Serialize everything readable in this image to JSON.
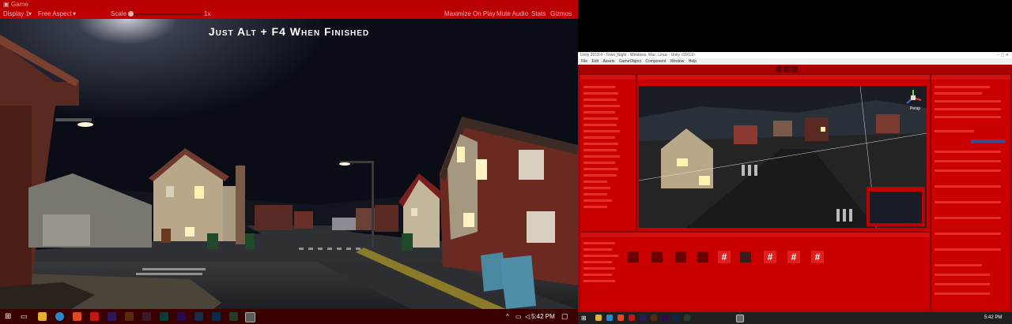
{
  "game_window": {
    "title": "Game",
    "toolbar": {
      "display": "Display 1",
      "aspect": "Free Aspect",
      "scale_label": "Scale",
      "scale_value": "1x",
      "maximize_on_play": "Maximize On Play",
      "mute_audio": "Mute Audio",
      "stats": "Stats",
      "gizmos": "Gizmos"
    },
    "overlay_text": "Just Alt + F4 When Finished"
  },
  "taskbar_left": {
    "time": "5:42 PM",
    "icons": [
      "windows-icon",
      "search-icon",
      "taskview-icon",
      "file-explorer-icon",
      "edge-icon",
      "brave-icon",
      "acrobat-icon",
      "after-effects-icon",
      "illustrator-icon",
      "animate-icon",
      "audition-icon",
      "premiere-icon",
      "character-animator-icon",
      "photoshop-icon",
      "substance-icon",
      "bridge-icon",
      "unity-icon",
      "visual-studio-icon"
    ]
  },
  "unity_editor": {
    "title": "Unity 2019.4 - Town_Night - Windows, Mac, Linux - Unity <DX11>",
    "menu": [
      "File",
      "Edit",
      "Assets",
      "GameObject",
      "Component",
      "Window",
      "Help"
    ],
    "scene_label": "Persp",
    "project_header": "Project",
    "inspector_header": "Inspector",
    "hierarchy_header": "Hierarchy"
  },
  "taskbar_right": {
    "time": "5:42 PM"
  },
  "colors": {
    "editor_tint": "#c00000",
    "night_sky": "#0e1424",
    "street_light": "#fff2c8"
  }
}
